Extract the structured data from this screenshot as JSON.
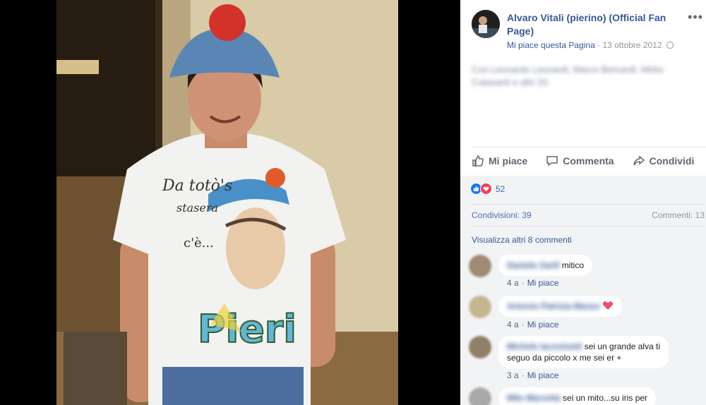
{
  "post": {
    "page_name": "Alvaro Vitali (pierino) (Official Fan Page)",
    "like_page_label": "Mi piace questa Pagina",
    "separator": "·",
    "date": "13 ottobre 2012",
    "blurred_caption": "Con Leonardo Leonardi, Marco Bernardi, Mirko Colasanti e altri 20."
  },
  "actions": {
    "like": "Mi piace",
    "comment": "Commenta",
    "share": "Condividi"
  },
  "stats": {
    "reaction_count": "52",
    "shares": "Condivisioni: 39",
    "comments": "Commenti: 13"
  },
  "more_comments_label": "Visualizza altri 8 commenti",
  "comments": [
    {
      "author": "Daniele Zanfi",
      "text": "mitico",
      "time": "4 a",
      "like": "Mi piace"
    },
    {
      "author": "Antonio Patrizia Manzo",
      "text": "",
      "time": "4 a",
      "like": "Mi piace"
    },
    {
      "author": "Michele Iacovinetti",
      "text": "sei un grande alva ti",
      "text2": "seguo da piccolo x me sei er +",
      "time": "3 a",
      "like": "Mi piace"
    },
    {
      "author": "Milo Marzetta",
      "text": "sei un mito...su iris per",
      "time": "",
      "like": ""
    }
  ],
  "colors": {
    "link_blue": "#385898",
    "like_blue": "#1877f2",
    "love_red": "#f33e58",
    "panel_grey": "#f2f3f5"
  }
}
